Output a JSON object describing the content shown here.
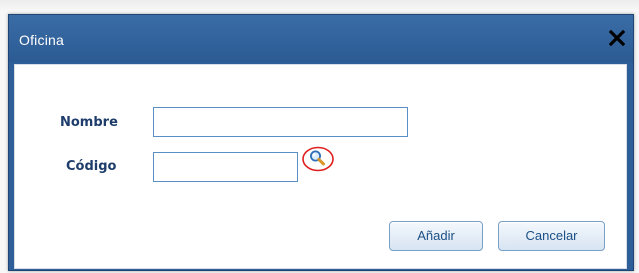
{
  "dialog": {
    "title": "Oficina",
    "close_icon": "close-x-icon"
  },
  "form": {
    "nombre_label": "Nombre",
    "nombre_value": "",
    "codigo_label": "Código",
    "codigo_value": "",
    "lookup_icon": "magnifier-search-icon"
  },
  "buttons": {
    "add_label": "Añadir",
    "cancel_label": "Cancelar"
  },
  "colors": {
    "titlebar": "#2f5f99",
    "label_text": "#1e3d6b",
    "input_border": "#5a8fc4",
    "highlight_circle": "#e01e1e"
  }
}
